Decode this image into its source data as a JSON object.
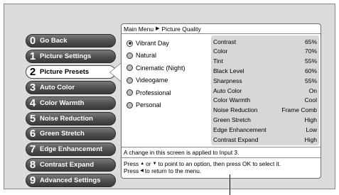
{
  "breadcrumb": {
    "root": "Main Menu",
    "current": "Picture Quality"
  },
  "menu": [
    {
      "num": "0",
      "label": "Go Back"
    },
    {
      "num": "1",
      "label": "Picture Settings"
    },
    {
      "num": "2",
      "label": "Picture Presets",
      "selected": true
    },
    {
      "num": "3",
      "label": "Auto Color"
    },
    {
      "num": "4",
      "label": "Color Warmth"
    },
    {
      "num": "5",
      "label": "Noise Reduction"
    },
    {
      "num": "6",
      "label": "Green Stretch"
    },
    {
      "num": "7",
      "label": "Edge Enhancement"
    },
    {
      "num": "8",
      "label": "Contrast Expand"
    },
    {
      "num": "9",
      "label": "Advanced Settings"
    }
  ],
  "presets": [
    {
      "label": "Vibrant Day",
      "checked": true
    },
    {
      "label": "Natural"
    },
    {
      "label": "Cinematic (Night)"
    },
    {
      "label": "Videogame"
    },
    {
      "label": "Professional"
    },
    {
      "label": "Personal"
    }
  ],
  "settings": [
    {
      "name": "Contrast",
      "value": "65%"
    },
    {
      "name": "Color",
      "value": "70%"
    },
    {
      "name": "Tint",
      "value": "55%"
    },
    {
      "name": "Black Level",
      "value": "60%"
    },
    {
      "name": "Sharpness",
      "value": "55%"
    },
    {
      "name": "Auto Color",
      "value": "On"
    },
    {
      "name": "Color Warmth",
      "value": "Cool"
    },
    {
      "name": "Noise Reduction",
      "value": "Frame Comb"
    },
    {
      "name": "Green Stretch",
      "value": "High"
    },
    {
      "name": "Edge Enhancement",
      "value": "Low"
    },
    {
      "name": "Contrast Expand",
      "value": "High"
    }
  ],
  "note": "A change in this screen is applied to Input 3.",
  "help": {
    "line1_a": "Press",
    "line1_b": "or",
    "line1_c": "to point to an option, then press OK to select it.",
    "line2_a": "Press",
    "line2_b": "to return to the menu."
  },
  "icons": {
    "breadcrumb_arrow": "▶",
    "up": "▲",
    "down": "▼",
    "left": "◀"
  }
}
